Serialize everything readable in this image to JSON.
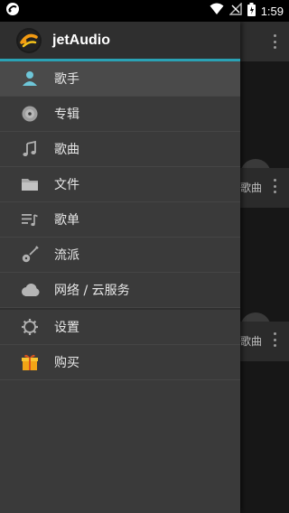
{
  "status_bar": {
    "time": "1:59"
  },
  "app": {
    "title": "jetAudio"
  },
  "menu": {
    "items": [
      {
        "label": "歌手",
        "icon": "artist-icon",
        "active": true
      },
      {
        "label": "专辑",
        "icon": "album-icon"
      },
      {
        "label": "歌曲",
        "icon": "music-note-icon"
      },
      {
        "label": "文件",
        "icon": "folder-icon"
      },
      {
        "label": "歌单",
        "icon": "playlist-icon"
      },
      {
        "label": "流派",
        "icon": "guitar-icon"
      },
      {
        "label": "网络 / 云服务",
        "icon": "cloud-icon"
      }
    ],
    "secondary_items": [
      {
        "label": "设置",
        "icon": "gear-icon"
      },
      {
        "label": "购买",
        "icon": "gift-icon"
      }
    ]
  },
  "background": {
    "card_peek_1": "歌曲",
    "card_peek_2": "歌曲"
  },
  "colors": {
    "accent": "#2aa2b5",
    "drawer_bg": "#3a3a3a",
    "header_bg": "#2f2f2f"
  }
}
